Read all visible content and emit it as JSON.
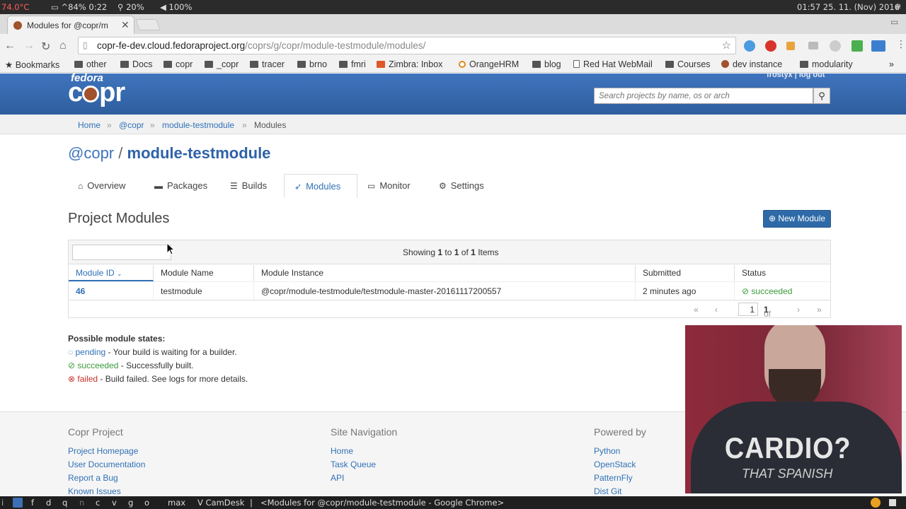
{
  "system_bar": {
    "temp": "74.0°C",
    "battery": "^84% 0:22",
    "brightness": "20%",
    "volume": "100%",
    "datetime": "01:57 25. 11. (Nov) 2016"
  },
  "browser": {
    "tab_title": "Modules for @copr/m",
    "url_domain": "copr-fe-dev.cloud.fedoraproject.org",
    "url_path": "/coprs/g/copr/module-testmodule/modules/",
    "bookmarks": [
      {
        "label": "Bookmarks",
        "icon": "star-icon"
      },
      {
        "label": "other",
        "icon": "folder-icon"
      },
      {
        "label": "Docs",
        "icon": "folder-icon"
      },
      {
        "label": "copr",
        "icon": "folder-icon"
      },
      {
        "label": "_copr",
        "icon": "folder-icon"
      },
      {
        "label": "tracer",
        "icon": "folder-icon"
      },
      {
        "label": "brno",
        "icon": "folder-icon"
      },
      {
        "label": "fmri",
        "icon": "folder-icon"
      },
      {
        "label": "Zimbra: Inbox",
        "icon": "zimbra-icon"
      },
      {
        "label": "OrangeHRM",
        "icon": "orangehrm-icon"
      },
      {
        "label": "blog",
        "icon": "folder-icon"
      },
      {
        "label": "Red Hat WebMail",
        "icon": "page-icon"
      },
      {
        "label": "Courses",
        "icon": "folder-icon"
      },
      {
        "label": "dev instance",
        "icon": "copr-icon"
      },
      {
        "label": "modularity",
        "icon": "folder-icon"
      }
    ]
  },
  "header": {
    "logo_top": "fedora",
    "logo_main": "copr",
    "user_links": "frostyx | log out",
    "search_placeholder": "Search projects by name, os or arch"
  },
  "breadcrumb": [
    "Home",
    "@copr",
    "module-testmodule",
    "Modules"
  ],
  "project": {
    "group": "@copr",
    "slash": "/",
    "name": "module-testmodule"
  },
  "tabs": [
    {
      "label": "Overview",
      "icon": "home-icon"
    },
    {
      "label": "Packages",
      "icon": "package-icon"
    },
    {
      "label": "Builds",
      "icon": "list-icon"
    },
    {
      "label": "Modules",
      "icon": "rocket-icon"
    },
    {
      "label": "Monitor",
      "icon": "monitor-icon"
    },
    {
      "label": "Settings",
      "icon": "settings-icon"
    }
  ],
  "section_title": "Project Modules",
  "new_module_label": "New Module",
  "table": {
    "showing_prefix": "Showing",
    "showing_from": "1",
    "showing_to_word": "to",
    "showing_to": "1",
    "showing_of_word": "of",
    "showing_total": "1",
    "showing_suffix": "Items",
    "columns": [
      "Module ID",
      "Module Name",
      "Module Instance",
      "Submitted",
      "Status"
    ],
    "rows": [
      {
        "id": "46",
        "name": "testmodule",
        "instance": "@copr/module-testmodule/testmodule-master-20161117200557",
        "submitted": "2 minutes ago",
        "status": "succeeded"
      }
    ],
    "pager": {
      "page": "1",
      "of": "of",
      "total": "1"
    }
  },
  "states": {
    "title": "Possible module states:",
    "items": [
      {
        "name": "pending",
        "desc": " - Your build is waiting for a builder.",
        "color": "#3071b6"
      },
      {
        "name": "succeeded",
        "desc": " - Successfully built.",
        "color": "#3c9a3c"
      },
      {
        "name": "failed",
        "desc": " - Build failed. See logs for more details.",
        "color": "#c9302c"
      }
    ]
  },
  "footer": {
    "col1": {
      "title": "Copr Project",
      "links": [
        "Project Homepage",
        "User Documentation",
        "Report a Bug",
        "Known Issues"
      ]
    },
    "col2": {
      "title": "Site Navigation",
      "links": [
        "Home",
        "Task Queue",
        "API"
      ]
    },
    "col3": {
      "title": "Powered by",
      "links": [
        "Python",
        "OpenStack",
        "PatternFly",
        "Dist Git"
      ]
    }
  },
  "webcam": {
    "shirt_text": "CARDIO?",
    "shirt_subtext": "THAT SPANISH"
  },
  "taskbar": {
    "workspaces": [
      "i",
      "f",
      "d",
      "q",
      "n",
      "c",
      "v",
      "g",
      "o"
    ],
    "max": "max",
    "camdesk": "V CamDesk",
    "separator": "|",
    "window_title": "<Modules for @copr/module-testmodule - Google Chrome>"
  },
  "colors": {
    "accent": "#3071b6",
    "header": "#3b6eb5",
    "success": "#3c9a3c",
    "danger": "#c9302c"
  }
}
